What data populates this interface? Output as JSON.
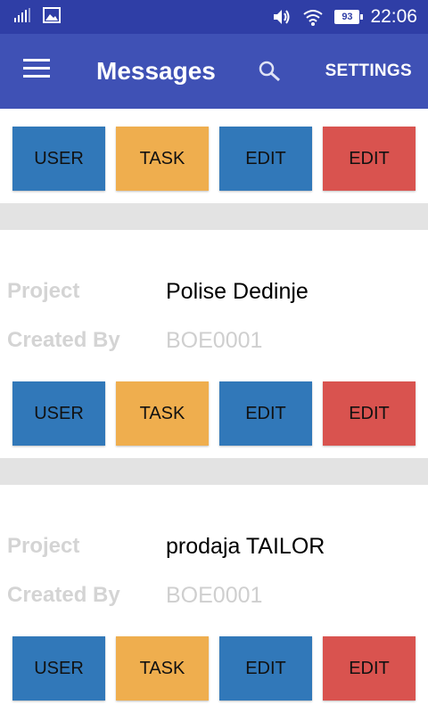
{
  "status_bar": {
    "battery": "93",
    "time": "22:06"
  },
  "app_bar": {
    "title": "Messages",
    "settings_label": "SETTINGS"
  },
  "labels": {
    "project": "Project",
    "created_by": "Created By"
  },
  "buttons": {
    "user": "USER",
    "task": "TASK",
    "edit": "EDIT",
    "edit_danger": "EDIT"
  },
  "colors": {
    "status_bar": "#2f3ea6",
    "app_bar": "#3f51b5",
    "user_button": "#3178b9",
    "task_button": "#efae4e",
    "edit_button": "#3178b9",
    "edit_danger_button": "#d9534f",
    "divider": "#e3e3e3"
  },
  "cards": [
    {
      "project": "",
      "created_by": ""
    },
    {
      "project": "Polise Dedinje",
      "created_by": "BOE0001"
    },
    {
      "project": "prodaja TAILOR",
      "created_by": "BOE0001"
    }
  ]
}
